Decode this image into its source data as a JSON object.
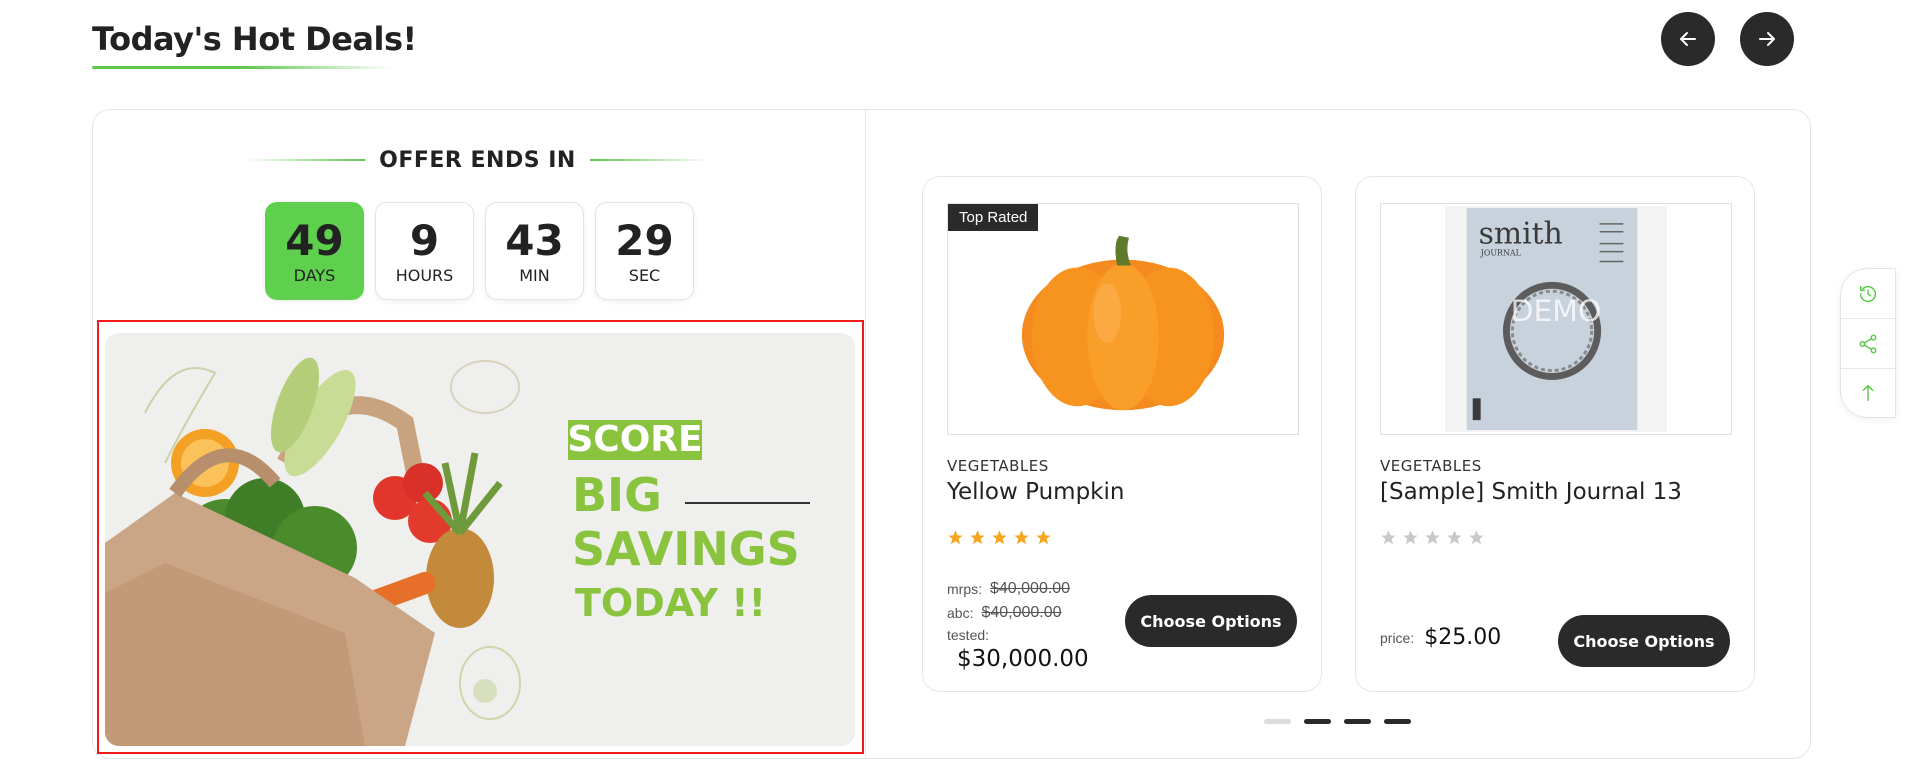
{
  "section": {
    "title": "Today's Hot Deals!"
  },
  "nav": {
    "prev_icon": "arrow-left-icon",
    "next_icon": "arrow-right-icon"
  },
  "offer": {
    "heading": "OFFER ENDS IN",
    "countdown": [
      {
        "value": "49",
        "label": "DAYS"
      },
      {
        "value": "9",
        "label": "HOURS"
      },
      {
        "value": "43",
        "label": "MIN"
      },
      {
        "value": "29",
        "label": "SEC"
      }
    ]
  },
  "banner": {
    "line1": "SCORE",
    "line2": "BIG",
    "line3": "SAVINGS",
    "line4": "TODAY !!"
  },
  "products": [
    {
      "badge": "Top Rated",
      "category": "VEGETABLES",
      "name": "Yellow Pumpkin",
      "rating": 5,
      "prices": [
        {
          "label": "mrps:",
          "value": "$40,000.00"
        },
        {
          "label": "abc:",
          "value": "$40,000.00"
        }
      ],
      "final_label": "tested:",
      "final_price": "$30,000.00",
      "button": "Choose Options"
    },
    {
      "category": "VEGETABLES",
      "name": "[Sample] Smith Journal 13",
      "rating": 0,
      "price_label": "price:",
      "price": "$25.00",
      "button": "Choose Options",
      "image_text": {
        "masthead": "smith",
        "sub": "JOURNAL",
        "watermark": "DEMO"
      }
    }
  ],
  "pagination": {
    "count": 4,
    "active_indices": [
      1,
      2,
      3
    ]
  },
  "side_widget": {
    "icons": [
      "history-icon",
      "share-icon",
      "arrow-up-icon"
    ]
  },
  "colors": {
    "accent": "#5fd04e",
    "dark": "#2a2a2a",
    "star": "#f5a623",
    "star_empty": "#c8c8c8",
    "highlight": "#ee1c1c"
  }
}
